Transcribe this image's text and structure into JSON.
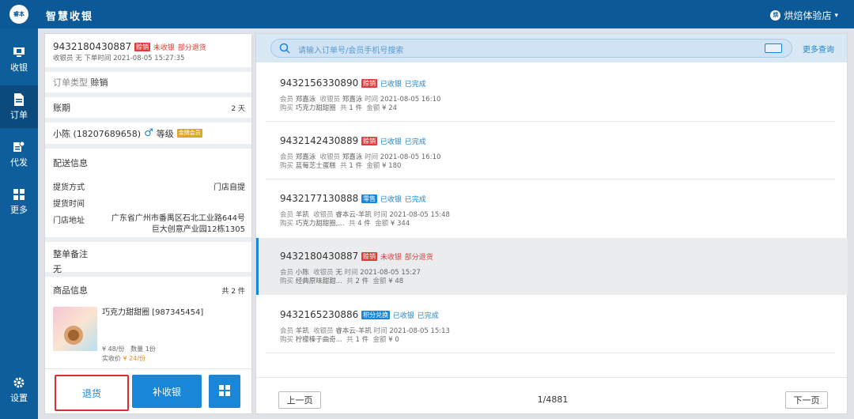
{
  "header": {
    "logo_text": "睿本",
    "app_title": "智慧收银",
    "store_icon_text": "烘",
    "store_name": "烘焙体验店",
    "caret": "▾"
  },
  "nav": [
    {
      "label": "收银",
      "icon": "monitor-icon"
    },
    {
      "label": "订单",
      "icon": "document-icon"
    },
    {
      "label": "代发",
      "icon": "delivery-icon"
    },
    {
      "label": "更多",
      "icon": "grid-icon"
    },
    {
      "label": "设置",
      "icon": "gear-icon"
    }
  ],
  "detail": {
    "order_no": "9432180430887",
    "type_tag": "赊销",
    "status1": "未收银",
    "status2": "部分退货",
    "meta": "收银员 无   下单时间 2021-08-05 15:27:35",
    "order_type_label": "订单类型",
    "order_type_value": "赊销",
    "term_label": "账期",
    "term_value": "2 天",
    "customer": "小陈 (18207689658)",
    "gender": "♂",
    "level_label": "等级",
    "level_tag": "金牌会员",
    "delivery_title": "配送信息",
    "pickup_method_label": "提货方式",
    "pickup_method_value": "门店自提",
    "pickup_time_label": "提货时间",
    "store_addr_label": "门店地址",
    "store_addr_line1": "广东省广州市番禺区石北工业路644号",
    "store_addr_line2": "巨大创意产业园12栋1305",
    "remark_title": "整单备注",
    "remark_value": "无",
    "goods_title": "商品信息",
    "goods_count": "共 2 件",
    "item_name": "巧克力甜甜圈 [987345454]",
    "item_price": "¥ 48/份",
    "item_qty": "数量 1份",
    "item_paid_label": "实收价",
    "item_paid": "¥ 24/份"
  },
  "actions": {
    "return_label": "退货",
    "recollect_label": "补收银"
  },
  "search": {
    "placeholder": "请输入订单号/会员手机号搜索",
    "more": "更多查询"
  },
  "orders": [
    {
      "no": "9432156330890",
      "tag": "赊销",
      "tag_color": "#e23b3b",
      "s1": "已收银",
      "s1_color": "#1a86d8",
      "s2": "已完成",
      "s2_color": "#1a86d8",
      "member": "郑嘉泳",
      "cashier": "郑嘉泳",
      "time": "2021-08-05 16:10",
      "item": "巧克力甜甜圈",
      "count": "1 件",
      "amount": "¥ 24"
    },
    {
      "no": "9432142430889",
      "tag": "赊销",
      "tag_color": "#e23b3b",
      "s1": "已收银",
      "s1_color": "#1a86d8",
      "s2": "已完成",
      "s2_color": "#1a86d8",
      "member": "郑嘉泳",
      "cashier": "郑嘉泳",
      "time": "2021-08-05 16:10",
      "item": "蓝莓芝士蛋糕",
      "count": "1 件",
      "amount": "¥ 180"
    },
    {
      "no": "9432177130888",
      "tag": "零售",
      "tag_color": "#1a86d8",
      "s1": "已收银",
      "s1_color": "#1a86d8",
      "s2": "已完成",
      "s2_color": "#1a86d8",
      "member": "羊凯",
      "cashier": "睿本云-羊凯",
      "time": "2021-08-05 15:48",
      "item": "巧克力甜甜圈,...",
      "count": "4 件",
      "amount": "¥ 344"
    },
    {
      "no": "9432180430887",
      "tag": "赊销",
      "tag_color": "#e23b3b",
      "s1": "未收银",
      "s1_color": "#e23b3b",
      "s2": "部分退货",
      "s2_color": "#e23b3b",
      "member": "小陈",
      "cashier": "无",
      "time": "2021-08-05 15:27",
      "item": "经典原味甜甜...",
      "count": "2 件",
      "amount": "¥ 48"
    },
    {
      "no": "9432165230886",
      "tag": "积分兑换",
      "tag_color": "#1a86d8",
      "s1": "已收银",
      "s1_color": "#1a86d8",
      "s2": "已完成",
      "s2_color": "#1a86d8",
      "member": "羊凯",
      "cashier": "睿本云-羊凯",
      "time": "2021-08-05 15:13",
      "item": "柠檬榛子曲奇...",
      "count": "1 件",
      "amount": "¥ 0"
    }
  ],
  "labels": {
    "member": "会员",
    "cashier": "收银员",
    "time": "时间",
    "buy": "购买",
    "total": "共",
    "amount": "金额"
  },
  "pagination": {
    "prev": "上一页",
    "page": "1/4881",
    "next": "下一页"
  }
}
